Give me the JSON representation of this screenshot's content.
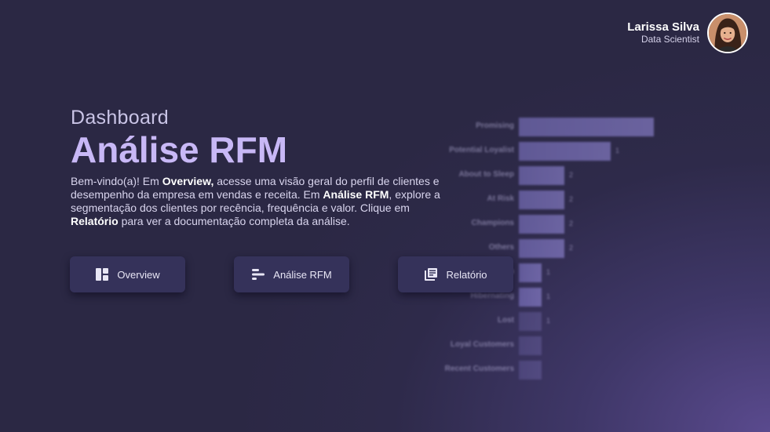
{
  "user": {
    "name": "Larissa Silva",
    "role": "Data Scientist"
  },
  "hero": {
    "eyebrow": "Dashboard",
    "title": "Análise RFM",
    "description": {
      "p1": "Bem-vindo(a)! Em ",
      "b1": "Overview,",
      "p2": " acesse uma visão geral do perfil de clientes e desempenho da empresa em vendas e receita. Em ",
      "b2": "Análise RFM",
      "p3": ", explore a segmentação dos clientes por recência, frequência e valor. Clique em ",
      "b3": "Relatório",
      "p4": " para ver a documentação completa da análise."
    }
  },
  "nav": {
    "overview_label": "Overview",
    "rfm_label": "Análise RFM",
    "report_label": "Relatório"
  },
  "icons": {
    "overview": "dashboard-layout-icon",
    "rfm": "bar-chart-horizontal-icon",
    "report": "library-books-icon"
  },
  "colors": {
    "accent_title": "#c8b8f6",
    "button_bg": "#35325a",
    "bar": "#8a80d6"
  },
  "chart_data": {
    "type": "bar",
    "orientation": "horizontal",
    "categories": [
      "Promising",
      "Potential Loyalist",
      "About to Sleep",
      "At Risk",
      "Champions",
      "Others",
      "Need Attention",
      "Hibernating",
      "Lost",
      "Loyal Customers",
      "Recent Customers"
    ],
    "values": [
      null,
      1,
      2,
      2,
      2,
      2,
      1,
      1,
      1,
      null,
      null
    ],
    "value_labels": [
      "",
      "1",
      "2",
      "2",
      "2",
      "2",
      "1",
      "1",
      "1",
      "",
      ""
    ],
    "bar_fractions": [
      1.0,
      0.68,
      0.34,
      0.34,
      0.34,
      0.34,
      0.17,
      0.17,
      0.17,
      0.17,
      0.17
    ]
  }
}
